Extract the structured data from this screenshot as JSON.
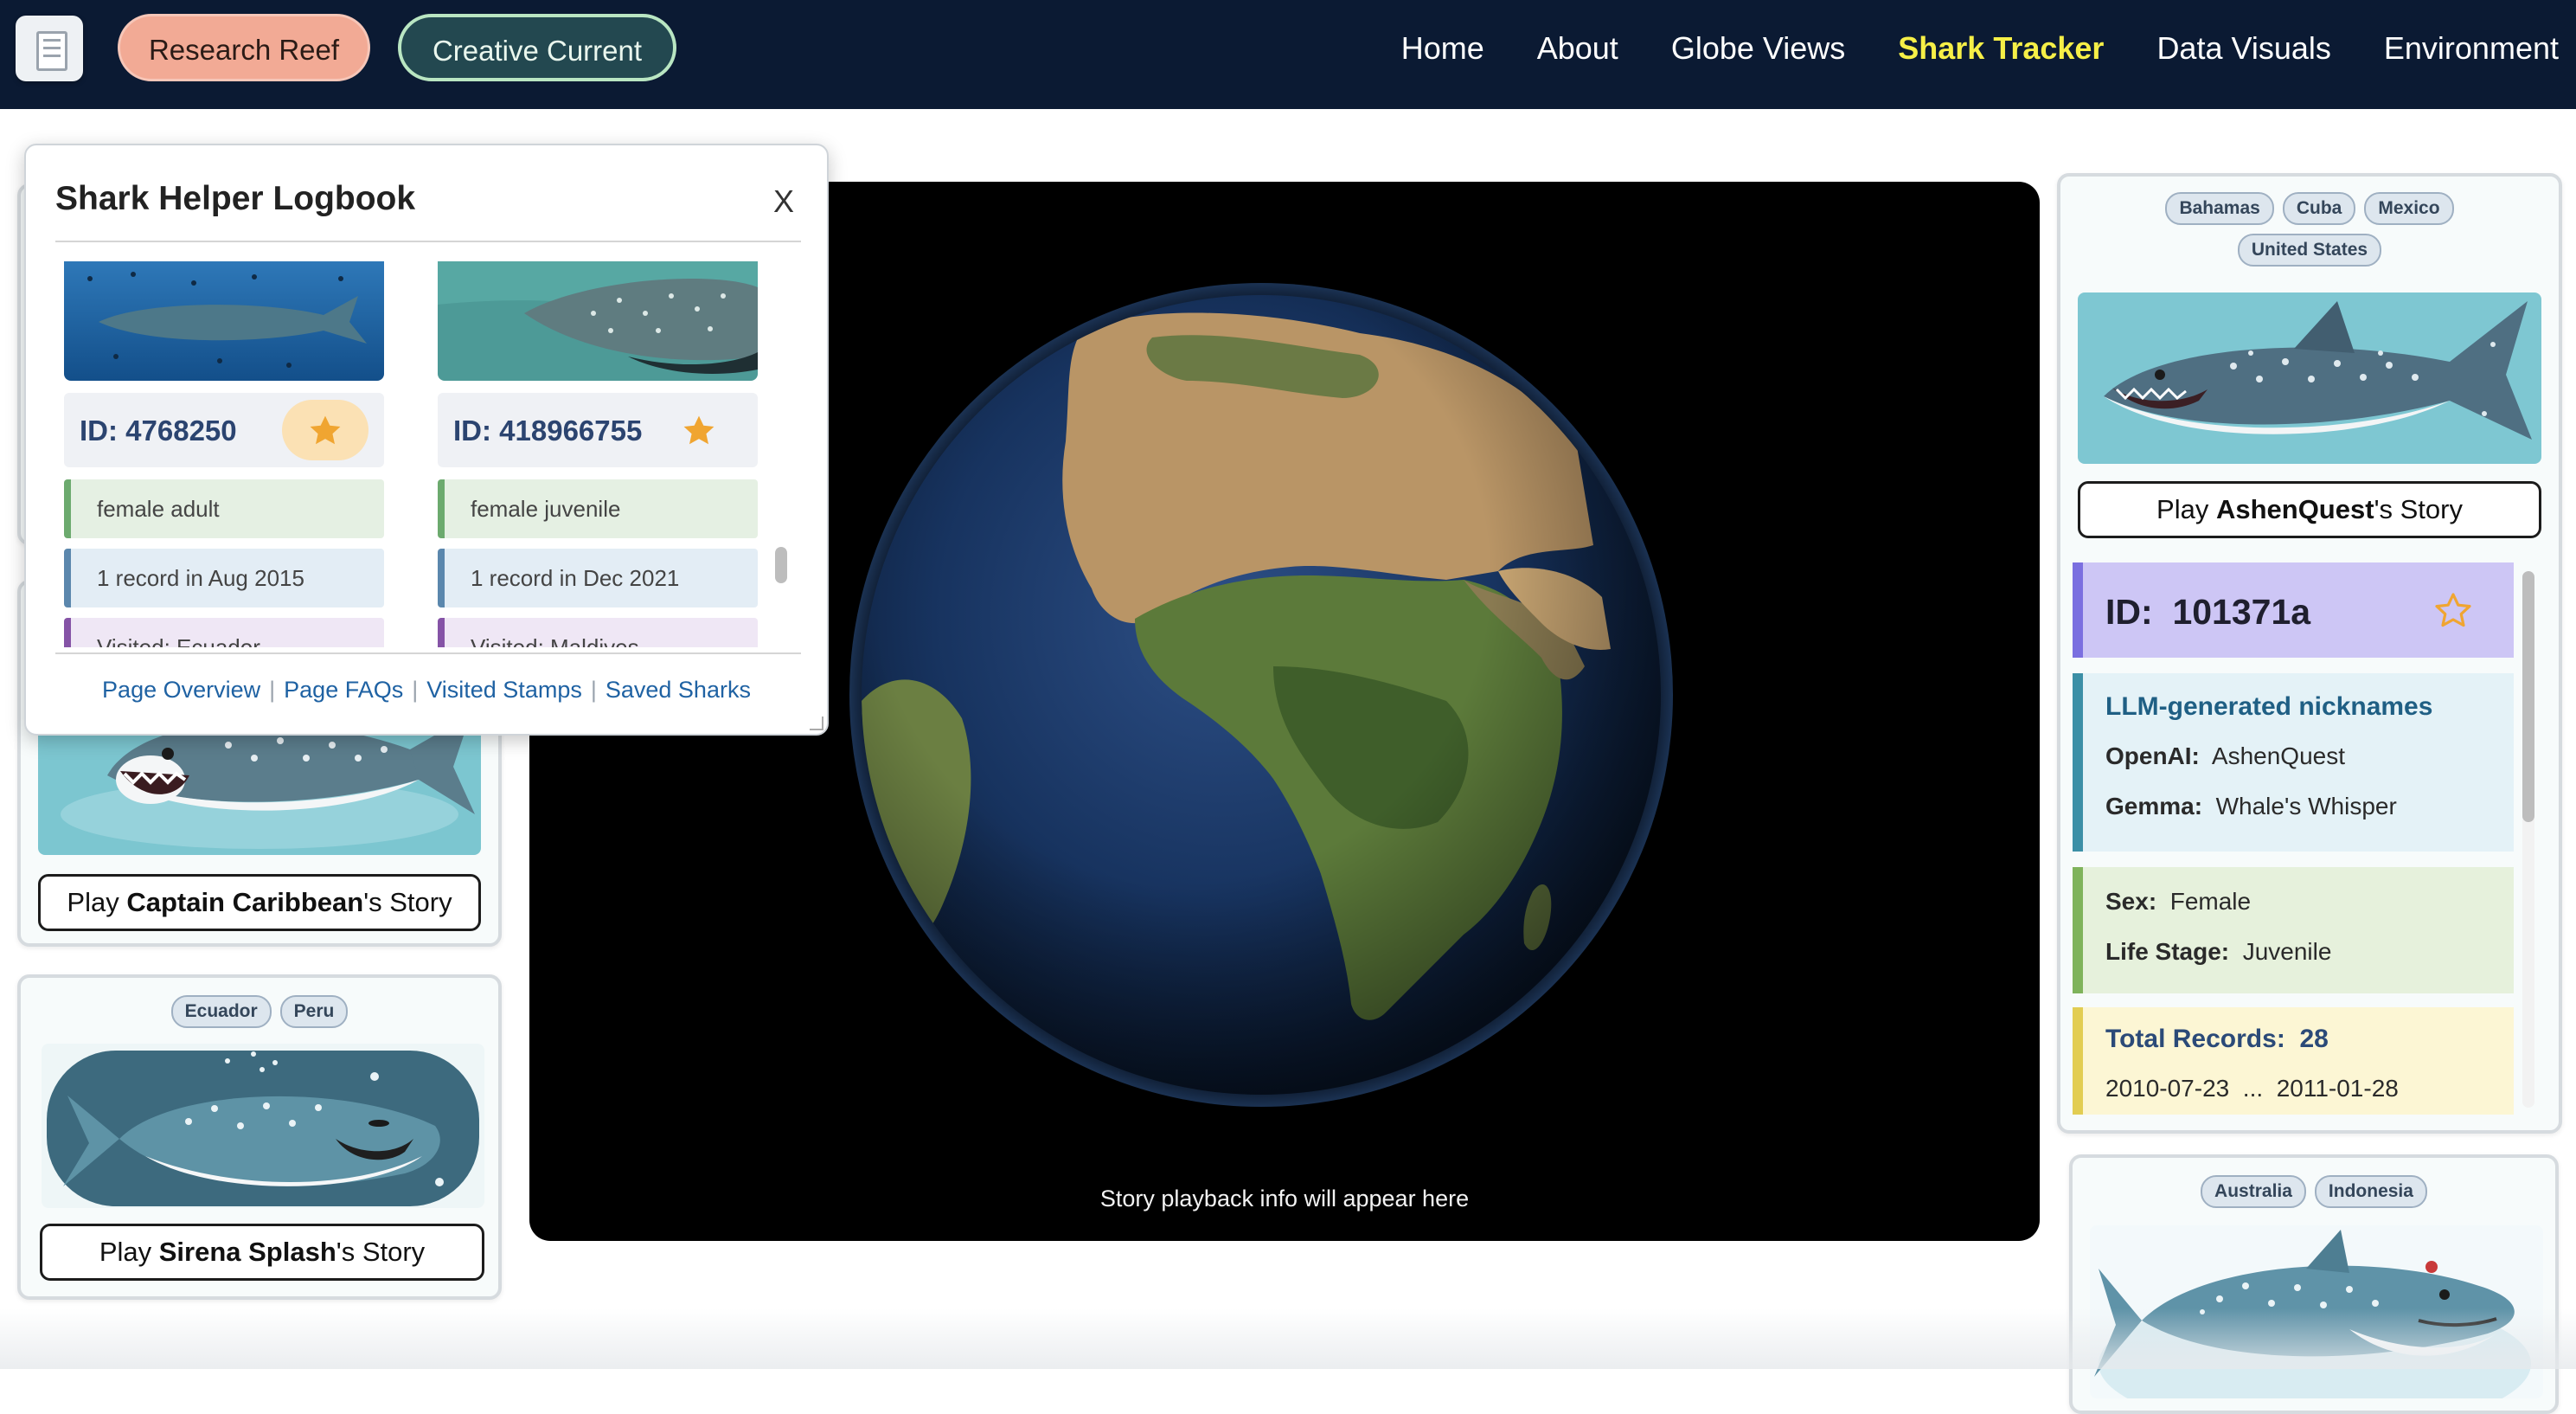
{
  "nav": {
    "logo_icon": "document-icon",
    "pills": [
      {
        "label": "Research Reef"
      },
      {
        "label": "Creative Current"
      }
    ],
    "links": [
      {
        "label": "Home",
        "active": false
      },
      {
        "label": "About",
        "active": false
      },
      {
        "label": "Globe Views",
        "active": false
      },
      {
        "label": "Shark Tracker",
        "active": true
      },
      {
        "label": "Data Visuals",
        "active": false
      },
      {
        "label": "Environment",
        "active": false
      }
    ]
  },
  "logbook": {
    "title": "Shark Helper Logbook",
    "close_label": "X",
    "entries": [
      {
        "id": "ID: 4768250",
        "starred": true,
        "sex_stage": "female adult",
        "records": "1 record in Aug 2015",
        "visited": "Visited: Ecuador"
      },
      {
        "id": "ID: 418966755",
        "starred": true,
        "sex_stage": "female juvenile",
        "records": "1 record in Dec 2021",
        "visited": "Visited: Maldives"
      }
    ],
    "footer_links": [
      "Page Overview",
      "Page FAQs",
      "Visited Stamps",
      "Saved Sharks"
    ]
  },
  "globe": {
    "caption": "Story playback info will appear here"
  },
  "left_cards": [
    {
      "play_prefix": "Play ",
      "name": "Captain Caribbean",
      "play_suffix": "'s Story"
    },
    {
      "tags": [
        "Ecuador",
        "Peru"
      ],
      "play_prefix": "Play ",
      "name": "Sirena Splash",
      "play_suffix": "'s Story"
    }
  ],
  "right_card": {
    "tags": [
      "Bahamas",
      "Cuba",
      "Mexico",
      "United States"
    ],
    "play_prefix": "Play ",
    "name": "AshenQuest",
    "play_suffix": "'s Story"
  },
  "detail": {
    "id_label": "ID:",
    "id_value": "101371a",
    "starred": false,
    "nick_heading": "LLM-generated nicknames",
    "nick_openai_label": "OpenAI:",
    "nick_openai_value": "AshenQuest",
    "nick_gemma_label": "Gemma:",
    "nick_gemma_value": "Whale's Whisper",
    "sex_label": "Sex:",
    "sex_value": "Female",
    "stage_label": "Life Stage:",
    "stage_value": "Juvenile",
    "records_label": "Total Records:",
    "records_value": "28",
    "date_start": "2010-07-23",
    "date_sep": "...",
    "date_end": "2011-01-28"
  },
  "right_card_bottom": {
    "tags": [
      "Australia",
      "Indonesia"
    ]
  },
  "colors": {
    "nav_bg": "#0b1a33",
    "active_link": "#f6ef47",
    "star": "#f0a531"
  }
}
